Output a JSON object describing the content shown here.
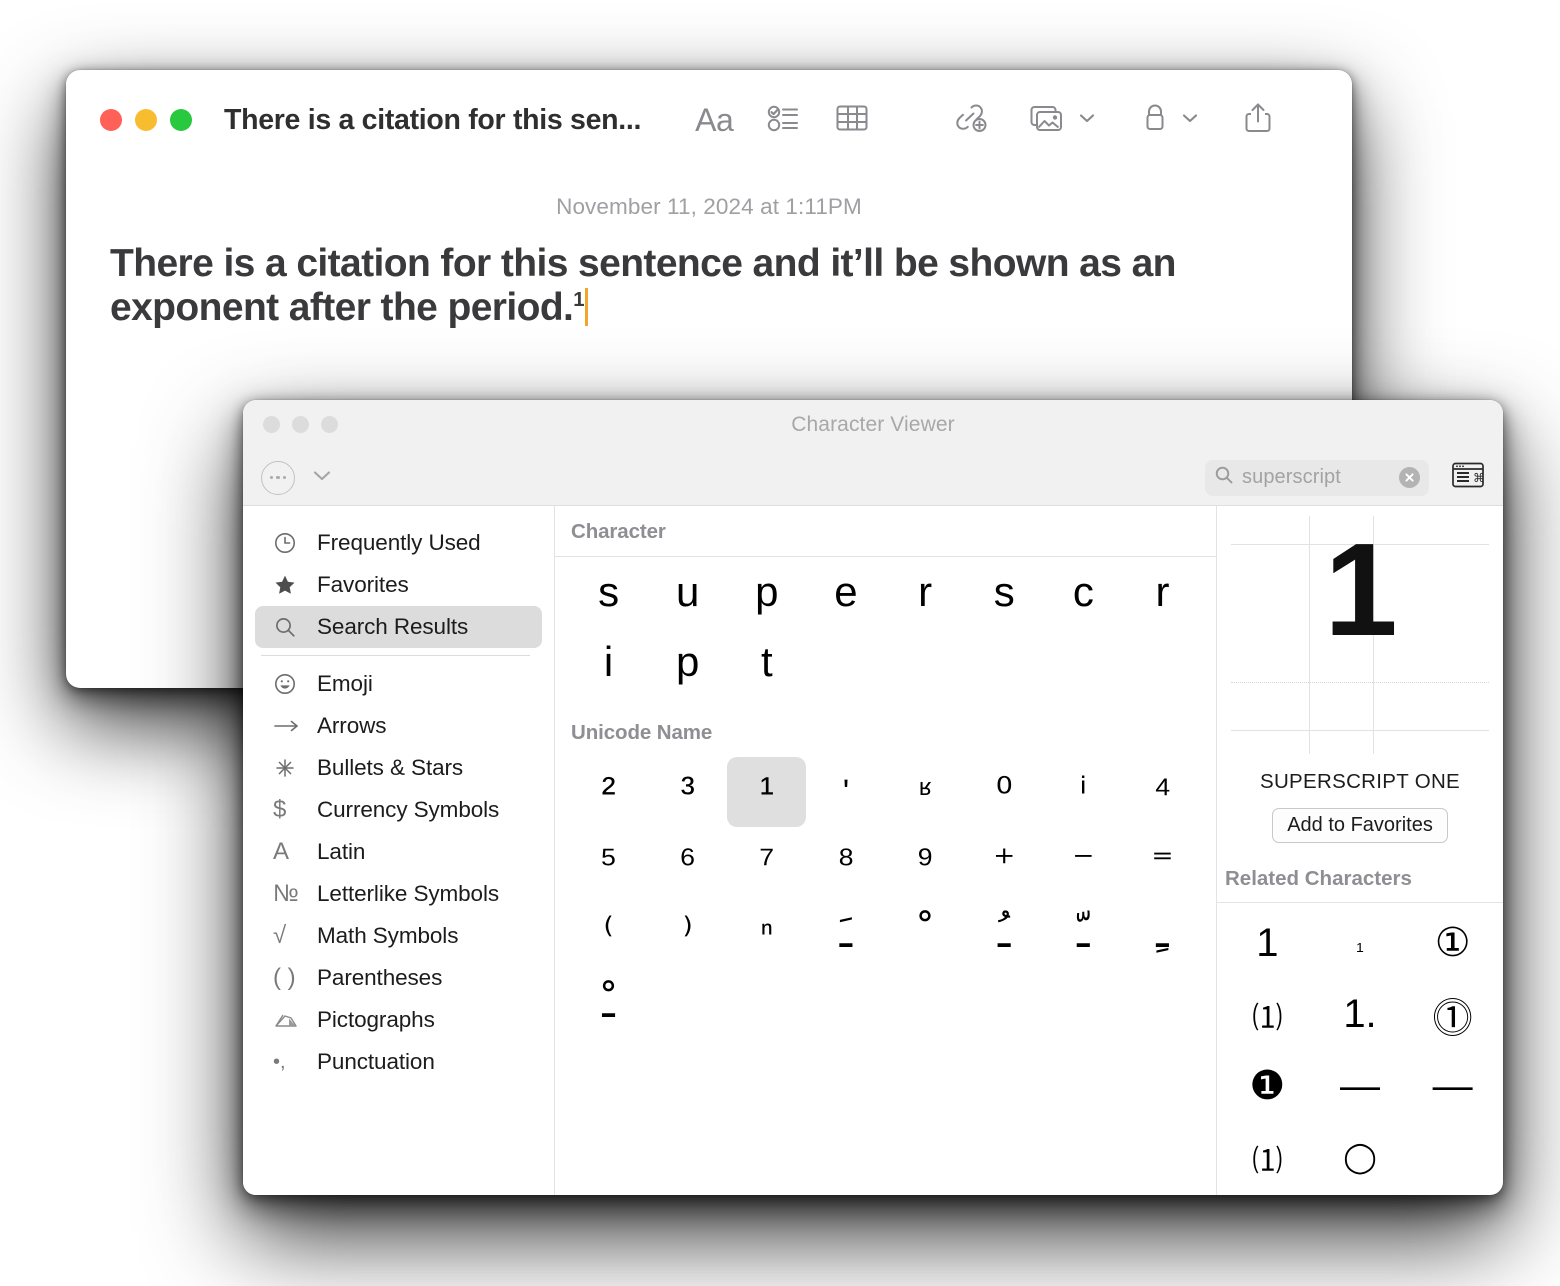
{
  "notes": {
    "title": "There is a citation for this sen...",
    "date": "November 11, 2024 at 1:11PM",
    "body_text": "There is a citation for this sentence and it’ll be shown as an exponent after the period.",
    "body_superscript": "1",
    "toolbar": {
      "format_label": "Aa",
      "checklist_label": "checklist-icon",
      "table_label": "table-icon",
      "link_label": "add-link-icon",
      "media_label": "media-icon",
      "lock_label": "lock-icon",
      "share_label": "share-icon"
    },
    "caret_color": "#f0a52c"
  },
  "character_viewer": {
    "title": "Character Viewer",
    "toolbar": {
      "more_label": "•••",
      "keyboard_viewer_label": "keyboard-viewer-icon"
    },
    "search": {
      "value": "superscript",
      "placeholder": "Search"
    },
    "sidebar": {
      "items": [
        {
          "label": "Frequently Used",
          "icon": "clock-icon",
          "selected": false
        },
        {
          "label": "Favorites",
          "icon": "star-icon",
          "selected": false
        },
        {
          "label": "Search Results",
          "icon": "search-icon",
          "selected": true
        },
        {
          "label": "Emoji",
          "icon": "smiley-icon",
          "selected": false
        },
        {
          "label": "Arrows",
          "icon": "arrow-right-icon",
          "selected": false
        },
        {
          "label": "Bullets & Stars",
          "icon": "asterisk-icon",
          "selected": false
        },
        {
          "label": "Currency Symbols",
          "icon": "dollar-icon",
          "selected": false
        },
        {
          "label": "Latin",
          "icon": "letter-a-icon",
          "selected": false
        },
        {
          "label": "Letterlike Symbols",
          "icon": "numero-icon",
          "selected": false
        },
        {
          "label": "Math Symbols",
          "icon": "radical-icon",
          "selected": false
        },
        {
          "label": "Parentheses",
          "icon": "parentheses-icon",
          "selected": false
        },
        {
          "label": "Pictographs",
          "icon": "pictograph-icon",
          "selected": false
        },
        {
          "label": "Punctuation",
          "icon": "punctuation-icon",
          "selected": false
        }
      ]
    },
    "sections": [
      {
        "header": "Character",
        "glyphs": [
          {
            "char": "s",
            "selected": false
          },
          {
            "char": "u",
            "selected": false
          },
          {
            "char": "p",
            "selected": false
          },
          {
            "char": "e",
            "selected": false
          },
          {
            "char": "r",
            "selected": false
          },
          {
            "char": "s",
            "selected": false
          },
          {
            "char": "c",
            "selected": false
          },
          {
            "char": "r",
            "selected": false
          },
          {
            "char": "i",
            "selected": false
          },
          {
            "char": "p",
            "selected": false
          },
          {
            "char": "t",
            "selected": false
          }
        ]
      },
      {
        "header": "Unicode Name",
        "glyphs": [
          {
            "char": "²",
            "selected": false
          },
          {
            "char": "³",
            "selected": false
          },
          {
            "char": "¹",
            "selected": true
          },
          {
            "char": "ʹ",
            "selected": false
          },
          {
            "char": "ʶ",
            "selected": false
          },
          {
            "char": "⁰",
            "selected": false
          },
          {
            "char": "ⁱ",
            "selected": false
          },
          {
            "char": "⁴",
            "selected": false
          },
          {
            "char": "⁵",
            "selected": false
          },
          {
            "char": "⁶",
            "selected": false
          },
          {
            "char": "⁷",
            "selected": false
          },
          {
            "char": "⁸",
            "selected": false
          },
          {
            "char": "⁹",
            "selected": false
          },
          {
            "char": "⁺",
            "selected": false
          },
          {
            "char": "⁻",
            "selected": false
          },
          {
            "char": "⁼",
            "selected": false
          },
          {
            "char": "⁽",
            "selected": false
          },
          {
            "char": "⁾",
            "selected": false
          },
          {
            "char": "ⁿ",
            "selected": false
          },
          {
            "char": "ﹷ",
            "selected": false
          },
          {
            "char": "ﹾ",
            "selected": false
          },
          {
            "char": "ﹹ",
            "selected": false
          },
          {
            "char": "ﹽ",
            "selected": false
          },
          {
            "char": "ﹻ",
            "selected": false
          },
          {
            "char": "ﹿ",
            "selected": false
          }
        ]
      }
    ],
    "detail": {
      "preview_glyph": "1",
      "unicode_name": "SUPERSCRIPT ONE",
      "add_to_favorites_label": "Add to Favorites",
      "related_header": "Related Characters",
      "related": [
        "1",
        "₁",
        "①",
        "⑴",
        "1.",
        "⓵",
        "❶",
        "—",
        "—",
        "⑴",
        "◯"
      ]
    }
  }
}
